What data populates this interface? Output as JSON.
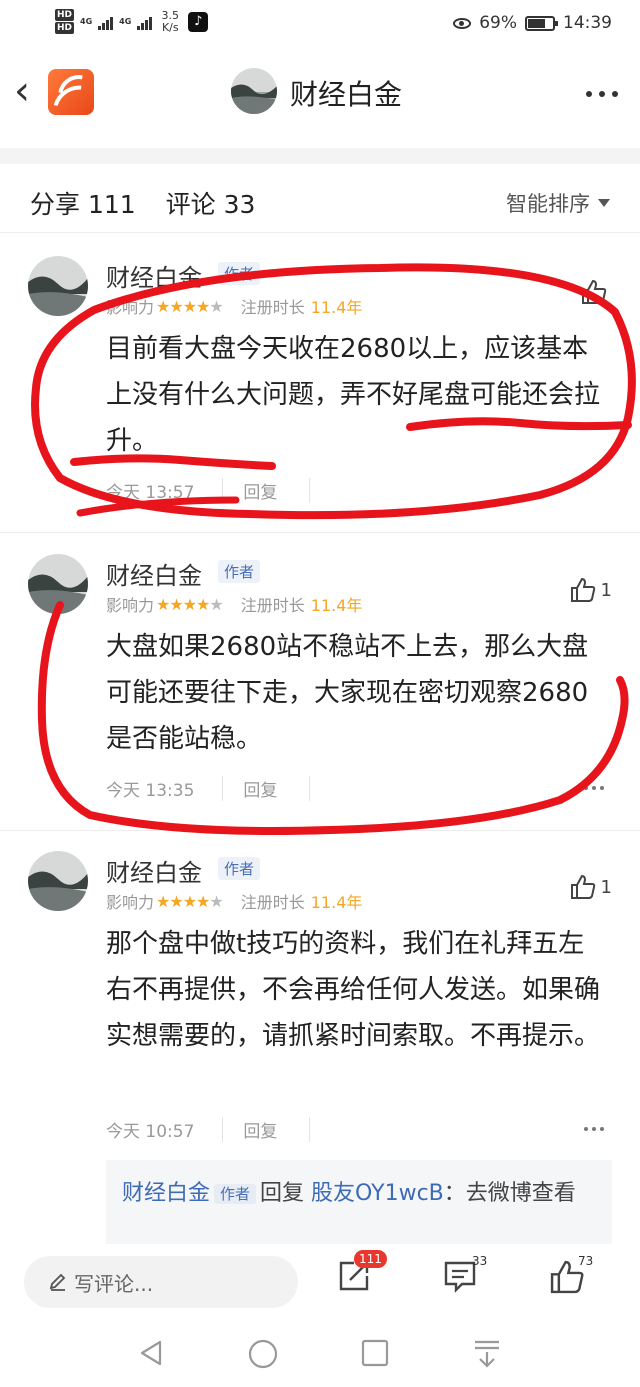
{
  "status_bar": {
    "hd1": "HD",
    "hd2": "HD",
    "net1": "4G",
    "net2": "4G",
    "speed_value": "3.5",
    "speed_unit": "K/s",
    "battery": "69%",
    "time": "14:39"
  },
  "nav": {
    "title": "财经白金",
    "back_icon": "chevron-left-icon",
    "more_icon": "more-horizontal-icon"
  },
  "summary": {
    "share_label": "分享 111",
    "comment_label": "评论 33",
    "sort_label": "智能排序"
  },
  "comments": [
    {
      "author": "财经白金",
      "tag": "作者",
      "influence_label": "影响力",
      "stars": "★★★★",
      "stars_empty": "★",
      "reg_label": "注册时长",
      "reg_value": "11.4年",
      "likes": "",
      "text": "目前看大盘今天收在2680以上，应该基本上没有什么大问题，弄不好尾盘可能还会拉升。",
      "time": "今天 13:57",
      "reply": "回复"
    },
    {
      "author": "财经白金",
      "tag": "作者",
      "influence_label": "影响力",
      "stars": "★★★★",
      "stars_empty": "★",
      "reg_label": "注册时长",
      "reg_value": "11.4年",
      "likes": "1",
      "text": "大盘如果2680站不稳站不上去，那么大盘可能还要往下走，大家现在密切观察2680是否能站稳。",
      "time": "今天 13:35",
      "reply": "回复"
    },
    {
      "author": "财经白金",
      "tag": "作者",
      "influence_label": "影响力",
      "stars": "★★★★",
      "stars_empty": "★",
      "reg_label": "注册时长",
      "reg_value": "11.4年",
      "likes": "1",
      "text": "那个盘中做t技巧的资料，我们在礼拜五左右不再提供，不会再给任何人发送。如果确实想需要的，请抓紧时间索取。不再提示。",
      "time": "今天 10:57",
      "reply": "回复"
    }
  ],
  "subreply": {
    "author": "财经白金",
    "tag": "作者",
    "action": "回复",
    "target": "股友OY1wcB",
    "text": "：去微博查看"
  },
  "bottom_bar": {
    "write_placeholder": "写评论...",
    "share_count": "111",
    "comment_count": "33",
    "like_count": "73"
  },
  "colors": {
    "accent_blue": "#3e6bb6",
    "star_orange": "#f5a623",
    "badge_red": "#e8372c",
    "annotation_red": "#e8141c",
    "app_logo_orange": "#f26a2e"
  }
}
